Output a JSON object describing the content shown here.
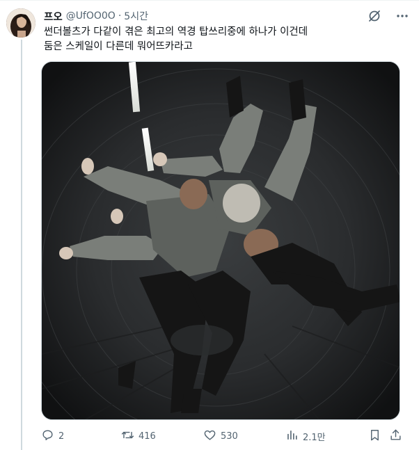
{
  "author": {
    "display_name": "프오",
    "handle": "@UfOO0O",
    "separator": "·",
    "time_ago": "5시간"
  },
  "tweet": {
    "lines": [
      "썬더볼츠가 다같이 겪은 최고의 역경 탑쓰리중에 하나가 이건데",
      "둠은 스케일이 다른데 뭐어뜨카라고"
    ]
  },
  "top_icons": [
    "grok-icon",
    "more-icon"
  ],
  "actions": {
    "replies": "2",
    "reposts": "416",
    "likes": "530",
    "views": "2.1만"
  },
  "colors": {
    "text": "#0f1419",
    "muted": "#536471",
    "border": "#cfd9de"
  }
}
